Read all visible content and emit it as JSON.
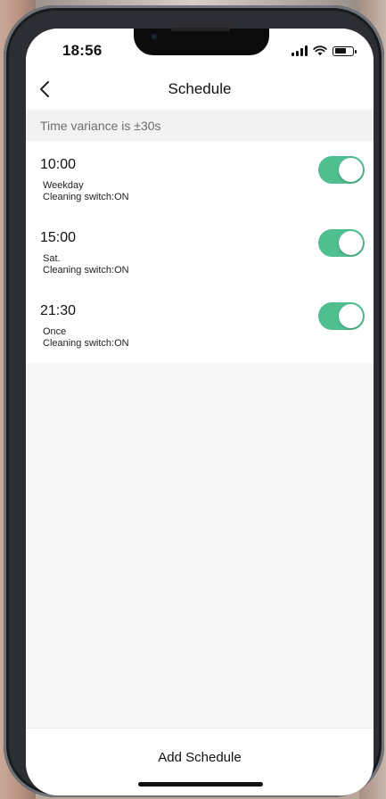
{
  "status_bar": {
    "time": "18:56",
    "signal_icon": "cellular-signal-icon",
    "wifi_icon": "wifi-icon",
    "battery_icon": "battery-icon",
    "battery_level": 0.65
  },
  "header": {
    "title": "Schedule",
    "back_icon": "chevron-left-icon"
  },
  "variance": {
    "text": "Time variance is  ±30s"
  },
  "schedules": [
    {
      "time": "10:00",
      "repeat": "Weekday",
      "action": "Cleaning switch:ON",
      "enabled": true
    },
    {
      "time": "15:00",
      "repeat": "Sat.",
      "action": "Cleaning switch:ON",
      "enabled": true
    },
    {
      "time": "21:30",
      "repeat": "Once",
      "action": "Cleaning switch:ON",
      "enabled": true
    }
  ],
  "footer": {
    "add_label": "Add Schedule"
  },
  "colors": {
    "toggle_on": "#50bf8f",
    "background": "#f7f7f7",
    "surface": "#ffffff",
    "muted_text": "#6e6e6e"
  }
}
